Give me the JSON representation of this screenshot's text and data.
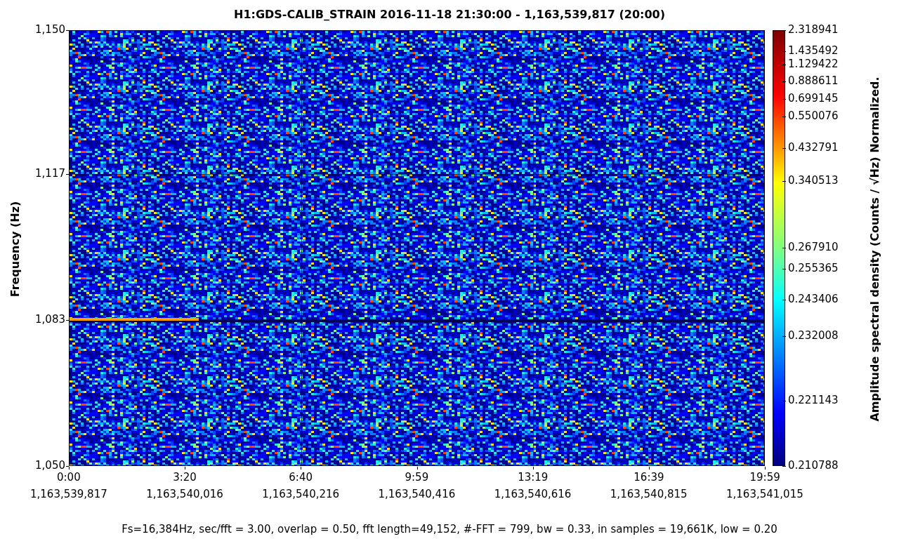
{
  "title": "H1:GDS-CALIB_STRAIN 2016-11-18 21:30:00 - 1,163,539,817 (20:00)",
  "y_axis": {
    "label": "Frequency (Hz)",
    "ticks": [
      "1,150",
      "1,117",
      "1,083",
      "1,050"
    ]
  },
  "x_axis": {
    "ticks": [
      {
        "time": "0:00",
        "gps": "1,163,539,817"
      },
      {
        "time": "3:20",
        "gps": "1,163,540,016"
      },
      {
        "time": "6:40",
        "gps": "1,163,540,216"
      },
      {
        "time": "9:59",
        "gps": "1,163,540,416"
      },
      {
        "time": "13:19",
        "gps": "1,163,540,616"
      },
      {
        "time": "16:39",
        "gps": "1,163,540,815"
      },
      {
        "time": "19:59",
        "gps": "1,163,541,015"
      }
    ]
  },
  "colorbar": {
    "label": "Amplitude spectral density (Counts / √Hz) Normalized.",
    "ticks": [
      "2.318941",
      "1.435492",
      "1.129422",
      "0.888611",
      "0.699145",
      "0.550076",
      "0.432791",
      "0.340513",
      "0.267910",
      "0.255365",
      "0.243406",
      "0.232008",
      "0.221143",
      "0.210788"
    ]
  },
  "caption": "Fs=16,384Hz, sec/fft = 3.00, overlap = 0.50, fft length=49,152, #-FFT = 799, bw = 0.33, in samples = 19,661K, low = 0.20"
}
